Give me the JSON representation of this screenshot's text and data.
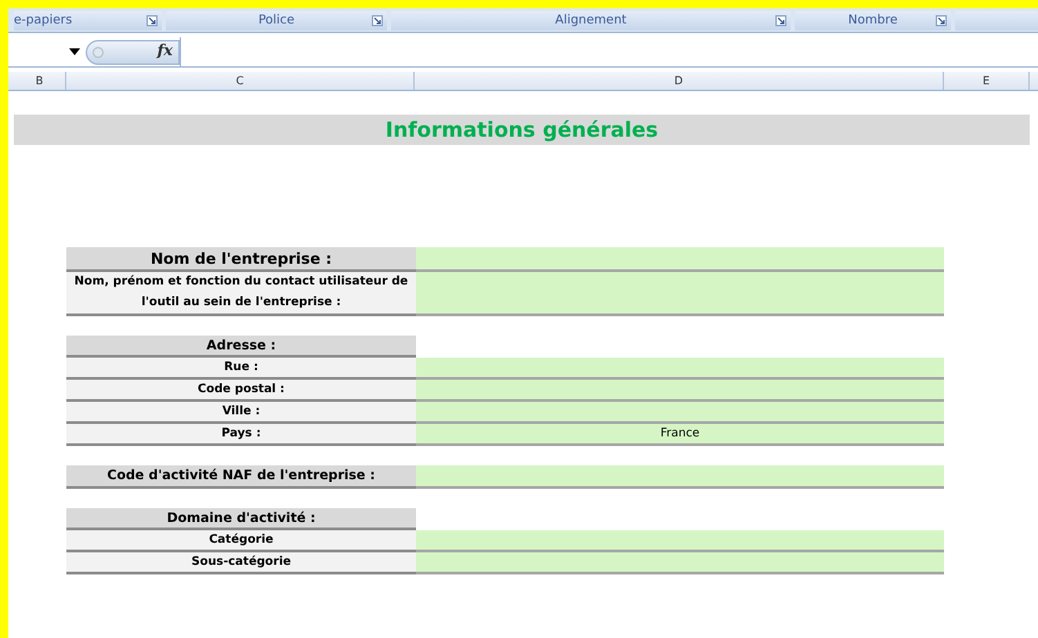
{
  "ribbon_groups": [
    {
      "label": "e-papiers"
    },
    {
      "label": "Police"
    },
    {
      "label": "Alignement"
    },
    {
      "label": "Nombre"
    }
  ],
  "formula_bar": {
    "fx": "fx"
  },
  "column_headers": [
    {
      "label": "B"
    },
    {
      "label": "C"
    },
    {
      "label": "D"
    },
    {
      "label": "E"
    }
  ],
  "sheet": {
    "title": "Informations générales",
    "sections": [
      {
        "rows": [
          {
            "kind": "main",
            "label": "Nom de l'entreprise :"
          },
          {
            "kind": "field",
            "label": "Nom, prénom et fonction du contact utilisateur de l'outil au sein de l'entreprise :"
          }
        ]
      },
      {
        "rows": [
          {
            "kind": "heading",
            "label": "Adresse :"
          },
          {
            "kind": "field",
            "label": "Rue :"
          },
          {
            "kind": "field",
            "label": "Code postal :"
          },
          {
            "kind": "field",
            "label": "Ville :"
          },
          {
            "kind": "field",
            "label": "Pays :",
            "value": "France"
          }
        ]
      },
      {
        "rows": [
          {
            "kind": "heading_field",
            "label": "Code d'activité NAF de l'entreprise :"
          }
        ]
      },
      {
        "rows": [
          {
            "kind": "heading",
            "label": "Domaine d'activité :"
          },
          {
            "kind": "field",
            "label": "Catégorie"
          },
          {
            "kind": "field",
            "label": "Sous-catégorie"
          }
        ]
      }
    ]
  }
}
